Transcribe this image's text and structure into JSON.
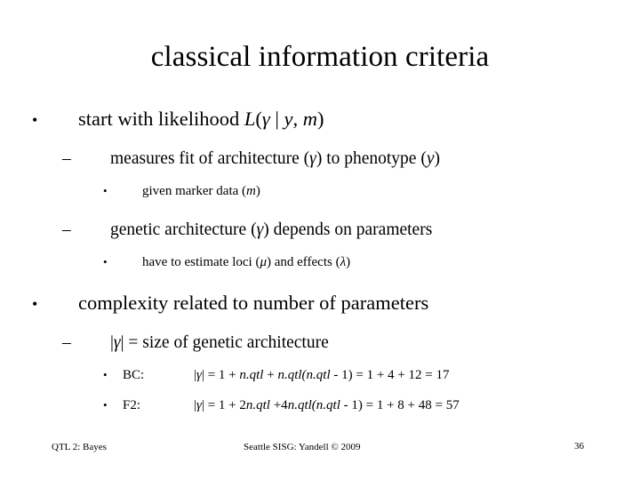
{
  "slide": {
    "title": "classical information criteria",
    "bullets": [
      {
        "level": 1,
        "marker": "•",
        "text_before": "start with likelihood ",
        "math": "L(γ | y, m)"
      },
      {
        "level": 2,
        "marker": "–",
        "text": "measures fit of architecture (γ) to phenotype (y)"
      },
      {
        "level": 3,
        "marker": "•",
        "text": "given marker data (m)"
      },
      {
        "level": 2,
        "marker": "–",
        "text": "genetic architecture (γ) depends on parameters"
      },
      {
        "level": 3,
        "marker": "•",
        "text": "have to estimate loci (μ) and effects (λ)"
      },
      {
        "level": 1,
        "marker": "•",
        "text": "complexity related to number of parameters"
      },
      {
        "level": 2,
        "marker": "–",
        "text": "|γ| = size of genetic architecture"
      },
      {
        "level": 3,
        "marker": "•",
        "label": "BC:",
        "formula": "|γ| = 1 + n.qtl + n.qtl(n.qtl - 1) = 1 + 4 + 12 = 17"
      },
      {
        "level": 3,
        "marker": "•",
        "label": "F2:",
        "formula": "|γ| = 1 + 2n.qtl +4n.qtl(n.qtl - 1) = 1 + 8 + 48 = 57"
      }
    ]
  },
  "line_parts": {
    "b1_bullet": "•",
    "b1_text": "start with likelihood ",
    "b1_math_L": "L",
    "b1_math_open": "(",
    "b1_math_gamma": "γ",
    "b1_math_bar": " | ",
    "b1_math_y": "y",
    "b1_math_comma": ", ",
    "b1_math_m": "m",
    "b1_math_close": ")",
    "b2_bullet": "–",
    "b2_pre": "measures fit of architecture (",
    "b2_gamma": "γ",
    "b2_mid": ") to phenotype (",
    "b2_y": "y",
    "b2_post": ")",
    "b3_bullet": "•",
    "b3_pre": "given marker data (",
    "b3_m": "m",
    "b3_post": ")",
    "b4_bullet": "–",
    "b4_pre": "genetic architecture (",
    "b4_gamma": "γ",
    "b4_post": ") depends on parameters",
    "b5_bullet": "•",
    "b5_pre": "have to estimate loci (",
    "b5_mu": "μ",
    "b5_mid": ") and effects (",
    "b5_lambda": "λ",
    "b5_post": ")",
    "b6_bullet": "•",
    "b6_text": "complexity related to number of parameters",
    "b7_bullet": "–",
    "b7_open": "|",
    "b7_gamma": "γ",
    "b7_close": "|",
    "b7_rest": " = size of genetic architecture",
    "b8_bullet": "•",
    "b8_label": "BC:",
    "b8_open": "|",
    "b8_gamma": "γ",
    "b8_close": "|",
    "b8_eq1": " = 1 + ",
    "b8_t1": "n.qtl",
    "b8_eq2": " + ",
    "b8_t2": "n.qtl",
    "b8_paren1": "(",
    "b8_t3": "n.qtl",
    "b8_minus": " - 1)",
    "b8_result": " = 1 + 4 + 12 = 17",
    "b9_bullet": "•",
    "b9_label": "F2:",
    "b9_open": "|",
    "b9_gamma": "γ",
    "b9_close": "|",
    "b9_eq1": " = 1 + 2",
    "b9_t1": "n.qtl",
    "b9_eq2": " +4",
    "b9_t2": "n.qtl",
    "b9_paren1": "(",
    "b9_t3": "n.qtl",
    "b9_minus": " - 1)",
    "b9_result": " = 1 + 8 + 48 = 57"
  },
  "footer": {
    "left": "QTL 2: Bayes",
    "center": "Seattle SISG: Yandell © 2009",
    "right": "36"
  }
}
